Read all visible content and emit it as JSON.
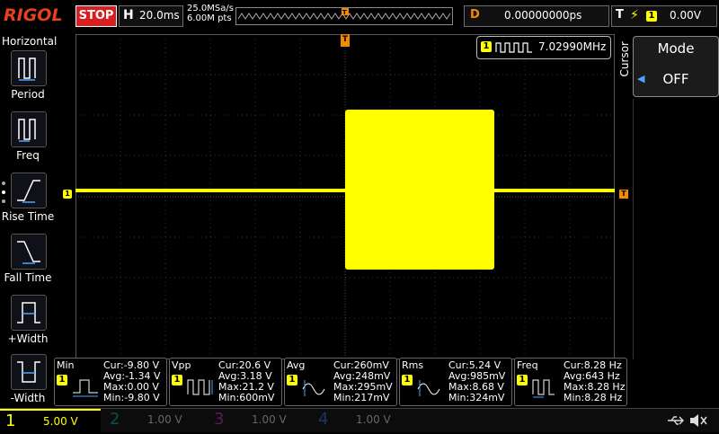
{
  "topbar": {
    "logo": "RIGOL",
    "run_state": "STOP",
    "horizontal_key": "H",
    "timebase": "20.0ms",
    "sample_rate": "25.0MSa/s",
    "memory_depth": "6.00M pts",
    "delay_key": "D",
    "delay_value": "0.00000000ps",
    "trigger_key": "T",
    "trigger_source": "1",
    "trigger_level": "0.00V"
  },
  "left_menu": {
    "title": "Horizontal",
    "items": [
      {
        "label": "Period",
        "icon": "period-icon"
      },
      {
        "label": "Freq",
        "icon": "freq-icon"
      },
      {
        "label": "Rise Time",
        "icon": "rise-time-icon"
      },
      {
        "label": "Fall Time",
        "icon": "fall-time-icon"
      },
      {
        "label": "+Width",
        "icon": "pos-width-icon"
      },
      {
        "label": "-Width",
        "icon": "neg-width-icon"
      }
    ]
  },
  "right_panel": {
    "vertical_label": "Cursor",
    "mode_title": "Mode",
    "mode_value": "OFF"
  },
  "freq_counter": {
    "channel": "1",
    "value": "7.02990MHz"
  },
  "markers": {
    "ch1_left": "1",
    "trigger_top": "T",
    "trigger_right": "T"
  },
  "measurements": [
    {
      "name": "Min",
      "channel": "1",
      "lines": [
        "Cur:-9.80 V",
        "Avg:-1.34 V",
        "Max:0.00 V",
        "Min:-9.80 V"
      ]
    },
    {
      "name": "Vpp",
      "channel": "1",
      "lines": [
        "Cur:20.6 V",
        "Avg:3.18 V",
        "Max:21.2 V",
        "Min:600mV"
      ]
    },
    {
      "name": "Avg",
      "channel": "1",
      "lines": [
        "Cur:260mV",
        "Avg:248mV",
        "Max:295mV",
        "Min:217mV"
      ]
    },
    {
      "name": "Rms",
      "channel": "1",
      "lines": [
        "Cur:5.24 V",
        "Avg:985mV",
        "Max:8.68 V",
        "Min:324mV"
      ]
    },
    {
      "name": "Freq",
      "channel": "1",
      "lines": [
        "Cur:8.28 Hz",
        "Avg:643 Hz",
        "Max:8.28 Hz",
        "Min:8.28 Hz"
      ]
    }
  ],
  "channels": [
    {
      "num": "1",
      "scale": "5.00 V",
      "color": "#ffff00",
      "active": true
    },
    {
      "num": "2",
      "scale": "1.00 V",
      "color": "#00e5ff",
      "active": false
    },
    {
      "num": "3",
      "scale": "1.00 V",
      "color": "#ff00ff",
      "active": false
    },
    {
      "num": "4",
      "scale": "1.00 V",
      "color": "#3d7bff",
      "active": false
    }
  ],
  "status_icons": [
    "usb-icon",
    "speaker-muted-icon"
  ],
  "colors": {
    "ch1": "#ffff00",
    "trigger": "#f58a00",
    "stop": "#d81e1e",
    "grid": "#3a3a3a"
  }
}
